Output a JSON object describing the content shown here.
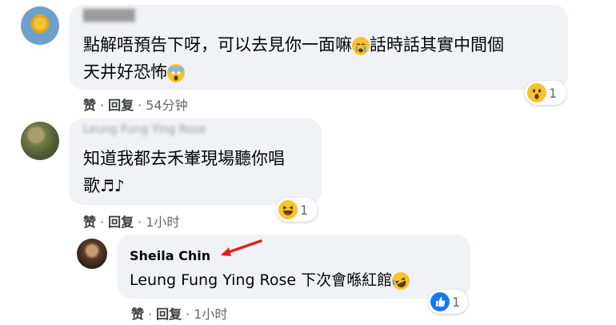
{
  "comments": [
    {
      "author": "██████",
      "text_lines": [
        "點解唔預告下呀，可以去見你一面嘛",
        "話時話其實中間個",
        "天井好恐怖"
      ],
      "actions": {
        "like": "赞",
        "reply": "回复",
        "time": "54分钟"
      },
      "reaction": {
        "icon": "wow-emoji-icon",
        "count": "1"
      }
    },
    {
      "author": "Leung Fung Ying Rose",
      "text_lines": [
        "知道我都去禾輋現場聽你唱",
        "歌"
      ],
      "actions": {
        "like": "赞",
        "reply": "回复",
        "time": "1小时"
      },
      "reaction": {
        "icon": "haha-emoji-icon",
        "count": "1"
      }
    }
  ],
  "reply": {
    "author": "Sheila Chin",
    "text": "Leung Fung Ying Rose 下次會喺紅館",
    "actions": {
      "like": "赞",
      "reply": "回复",
      "time": "1小时"
    },
    "reaction": {
      "icon": "like-icon",
      "count": "1"
    }
  },
  "colors": {
    "bubble": "#f0f2f5",
    "arrow": "#e0211a",
    "like_blue": "#1877f2",
    "emoji_yellow": "#f7c32e"
  }
}
